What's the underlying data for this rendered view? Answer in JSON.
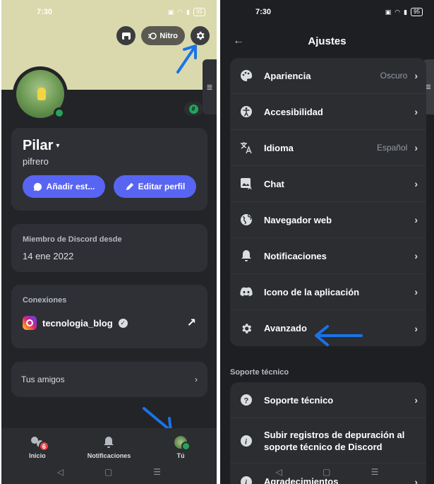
{
  "left": {
    "status": {
      "time": "7:30",
      "battery": "95"
    },
    "header": {
      "nitro_label": "Nitro"
    },
    "profile": {
      "display_name": "Pilar",
      "username": "pifrero"
    },
    "buttons": {
      "add_status": "Añadir est...",
      "edit_profile": "Editar perfil"
    },
    "member": {
      "label": "Miembro de Discord desde",
      "value": "14 ene 2022"
    },
    "connections": {
      "label": "Conexiones",
      "account": "tecnologia_blog"
    },
    "friends": {
      "label": "Tus amigos"
    },
    "nav": {
      "home_label": "Inicio",
      "home_badge": "6",
      "notifications_label": "Notificaciones",
      "you_label": "Tú"
    }
  },
  "right": {
    "status": {
      "time": "7:30",
      "battery": "95"
    },
    "title": "Ajustes",
    "settings": [
      {
        "label": "Apariencia",
        "value": "Oscuro",
        "icon": "palette-icon"
      },
      {
        "label": "Accesibilidad",
        "value": "",
        "icon": "accessibility-icon"
      },
      {
        "label": "Idioma",
        "value": "Español",
        "icon": "translate-icon"
      },
      {
        "label": "Chat",
        "value": "",
        "icon": "chat-image-icon"
      },
      {
        "label": "Navegador web",
        "value": "",
        "icon": "globe-icon"
      },
      {
        "label": "Notificaciones",
        "value": "",
        "icon": "bell-icon"
      },
      {
        "label": "Icono de la aplicación",
        "value": "",
        "icon": "discord-icon"
      },
      {
        "label": "Avanzado",
        "value": "",
        "icon": "gear-icon"
      }
    ],
    "support_title": "Soporte técnico",
    "support": [
      {
        "label": "Soporte técnico",
        "icon": "help-icon"
      },
      {
        "label": "Subir registros de depuración al soporte técnico de Discord",
        "icon": "info-icon"
      },
      {
        "label": "Agradecimientos",
        "icon": "info-icon"
      }
    ]
  },
  "colors": {
    "accent": "#5865f2",
    "online": "#23a55a",
    "annotation_arrow": "#1a73e8"
  }
}
